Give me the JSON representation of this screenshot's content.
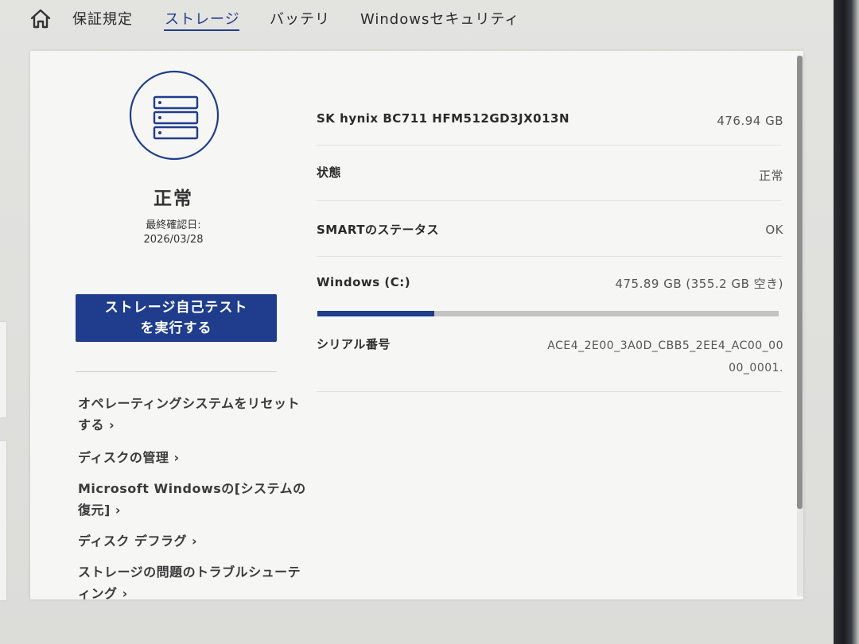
{
  "nav": {
    "tabs": [
      {
        "label": "保証規定"
      },
      {
        "label": "ストレージ"
      },
      {
        "label": "バッテリ"
      },
      {
        "label": "Windowsセキュリティ"
      }
    ]
  },
  "status": {
    "text": "正常",
    "last_check_label": "最終確認日:",
    "last_check_date": "2026/03/28",
    "icon": "storage-drives-icon"
  },
  "actions": {
    "selftest_line1": "ストレージ自己テスト",
    "selftest_line2": "を実行する"
  },
  "links": [
    {
      "label": "オペレーティングシステムをリセットする ›"
    },
    {
      "label": "ディスクの管理 ›"
    },
    {
      "label": "Microsoft Windowsの[システムの復元] ›"
    },
    {
      "label": "ディスク デフラグ ›"
    },
    {
      "label": "ストレージの問題のトラブルシューティング ›"
    }
  ],
  "drive": {
    "model": "SK hynix BC711 HFM512GD3JX013N",
    "capacity": "476.94 GB",
    "state_label": "状態",
    "state_value": "正常",
    "smart_label": "SMARTのステータス",
    "smart_value": "OK",
    "volume_label": "Windows (C:)",
    "volume_value": "475.89 GB (355.2 GB 空き)",
    "volume_used_fraction": 0.254,
    "serial_label": "シリアル番号",
    "serial_value": "ACE4_2E00_3A0D_CBB5_2EE4_AC00_0000_0001."
  },
  "colors": {
    "accent": "#1f3d8c",
    "card": "#f6f6f5",
    "text": "#2b2b2b"
  }
}
